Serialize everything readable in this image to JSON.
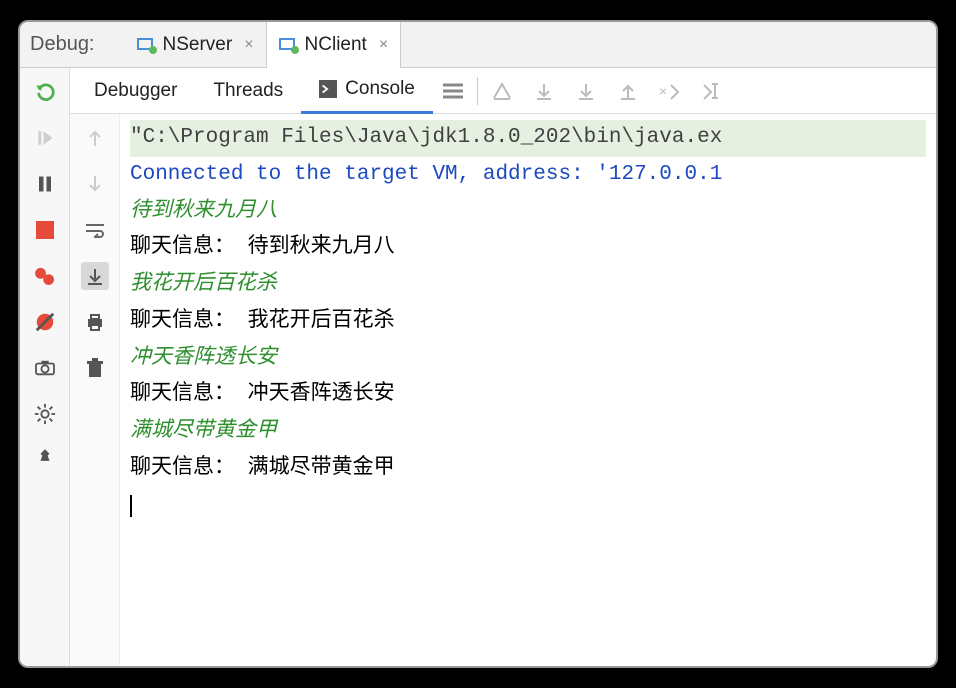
{
  "titlebar": {
    "label": "Debug:",
    "tabs": [
      {
        "name": "NServer",
        "active": false
      },
      {
        "name": "NClient",
        "active": true
      }
    ]
  },
  "leftToolbar": {
    "rerun": "rerun-icon",
    "resume": "resume-icon",
    "pause": "pause-icon",
    "stop": "stop-icon",
    "breakpoints": "breakpoints-icon",
    "mute": "mute-breakpoints-icon",
    "dump": "camera-icon",
    "settings": "gear-icon",
    "pin": "pin-icon"
  },
  "innerTabs": {
    "debugger": "Debugger",
    "threads": "Threads",
    "console": "Console"
  },
  "consoleToolbar": {
    "up": "up-arrow-icon",
    "down": "down-arrow-icon",
    "wrap": "soft-wrap-icon",
    "scroll": "scroll-to-end-icon",
    "print": "print-icon",
    "clear": "trash-icon"
  },
  "console": {
    "cmd": "\"C:\\Program Files\\Java\\jdk1.8.0_202\\bin\\java.ex",
    "connected": "Connected to the target VM, address: '127.0.0.1",
    "lines": [
      {
        "type": "input",
        "text": "待到秋来九月八"
      },
      {
        "type": "out",
        "text": "聊天信息： 待到秋来九月八"
      },
      {
        "type": "input",
        "text": "我花开后百花杀"
      },
      {
        "type": "out",
        "text": "聊天信息： 我花开后百花杀"
      },
      {
        "type": "input",
        "text": "冲天香阵透长安"
      },
      {
        "type": "out",
        "text": "聊天信息： 冲天香阵透长安"
      },
      {
        "type": "input",
        "text": "满城尽带黄金甲"
      },
      {
        "type": "out",
        "text": "聊天信息： 满城尽带黄金甲"
      }
    ]
  }
}
